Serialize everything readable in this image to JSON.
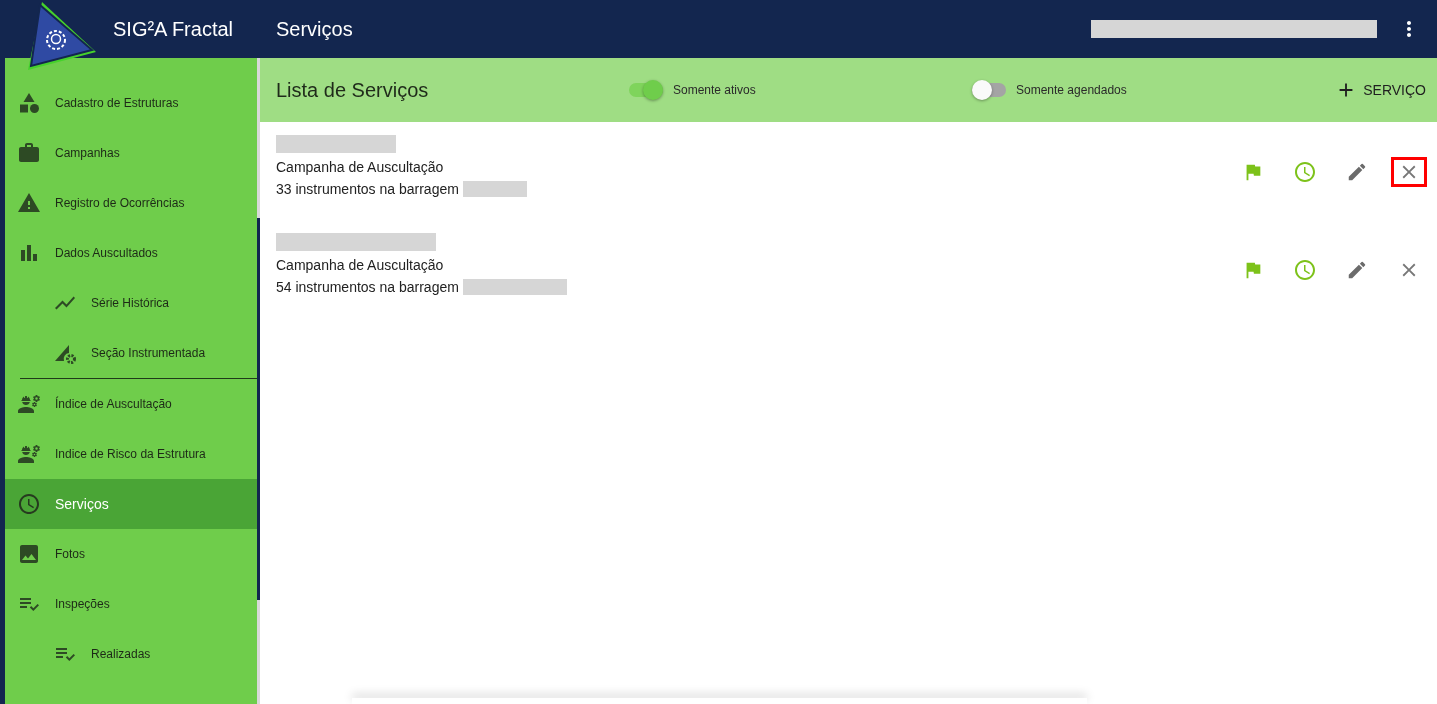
{
  "app_bar": {
    "app_name": "SIG²A Fractal",
    "page_title": "Serviços"
  },
  "sidebar": {
    "items": [
      {
        "label": "Cadastro de Estruturas",
        "selected": false
      },
      {
        "label": "Campanhas",
        "selected": false
      },
      {
        "label": "Registro de Ocorrências",
        "selected": false
      },
      {
        "label": "Dados Auscultados",
        "selected": false,
        "children": [
          {
            "label": "Série Histórica",
            "selected": false
          },
          {
            "label": "Seção Instrumentada",
            "selected": false
          }
        ]
      },
      {
        "label": "Índice de Auscultação",
        "selected": false
      },
      {
        "label": "Indice de Risco da Estrutura",
        "selected": false
      },
      {
        "label": "Serviços",
        "selected": true
      },
      {
        "label": "Fotos",
        "selected": false
      },
      {
        "label": "Inspeções",
        "selected": false,
        "children": [
          {
            "label": "Realizadas",
            "selected": false
          }
        ]
      }
    ]
  },
  "toolbar": {
    "title": "Lista de Serviços",
    "toggles": [
      {
        "label": "Somente ativos",
        "on": true
      },
      {
        "label": "Somente agendados",
        "on": false
      }
    ],
    "add_button": "SERVIÇO"
  },
  "services": [
    {
      "type": "Campanha de Auscultação",
      "detail": "33 instrumentos na barragem",
      "delete_highlighted": true
    },
    {
      "type": "Campanha de Auscultação",
      "detail": "54 instrumentos na barragem",
      "delete_highlighted": false
    }
  ]
}
